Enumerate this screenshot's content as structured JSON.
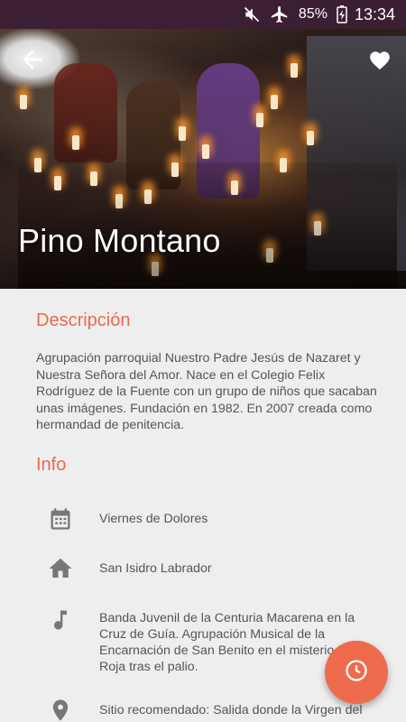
{
  "status_bar": {
    "battery": "85%",
    "time": "13:34"
  },
  "hero": {
    "title": "Pino Montano"
  },
  "description": {
    "heading": "Descripción",
    "text": "Agrupación parroquial Nuestro Padre Jesús de Nazaret y Nuestra Señora del Amor. Nace en el Colegio Felix Rodríguez de la Fuente con un grupo de niños que sacaban unas imágenes. Fundación en 1982. En 2007 creada como hermandad de penitencia."
  },
  "info": {
    "heading": "Info",
    "items": [
      {
        "icon": "calendar-icon",
        "text": "Viernes de Dolores"
      },
      {
        "icon": "home-icon",
        "text": "San Isidro Labrador"
      },
      {
        "icon": "music-note-icon",
        "text": "Banda Juvenil de la Centuria Macarena en la Cruz de Guía. Agrupación Musical de la Encarnación de San Benito en el misterio. Cruz Roja tras el palio."
      },
      {
        "icon": "location-pin-icon",
        "text": "Sitio recomendado: Salida donde la Virgen del"
      }
    ]
  },
  "colors": {
    "accent": "#e96a4c",
    "fab": "#ef6b4e",
    "status_bar": "#3d1f33",
    "background": "#eeeeee"
  }
}
